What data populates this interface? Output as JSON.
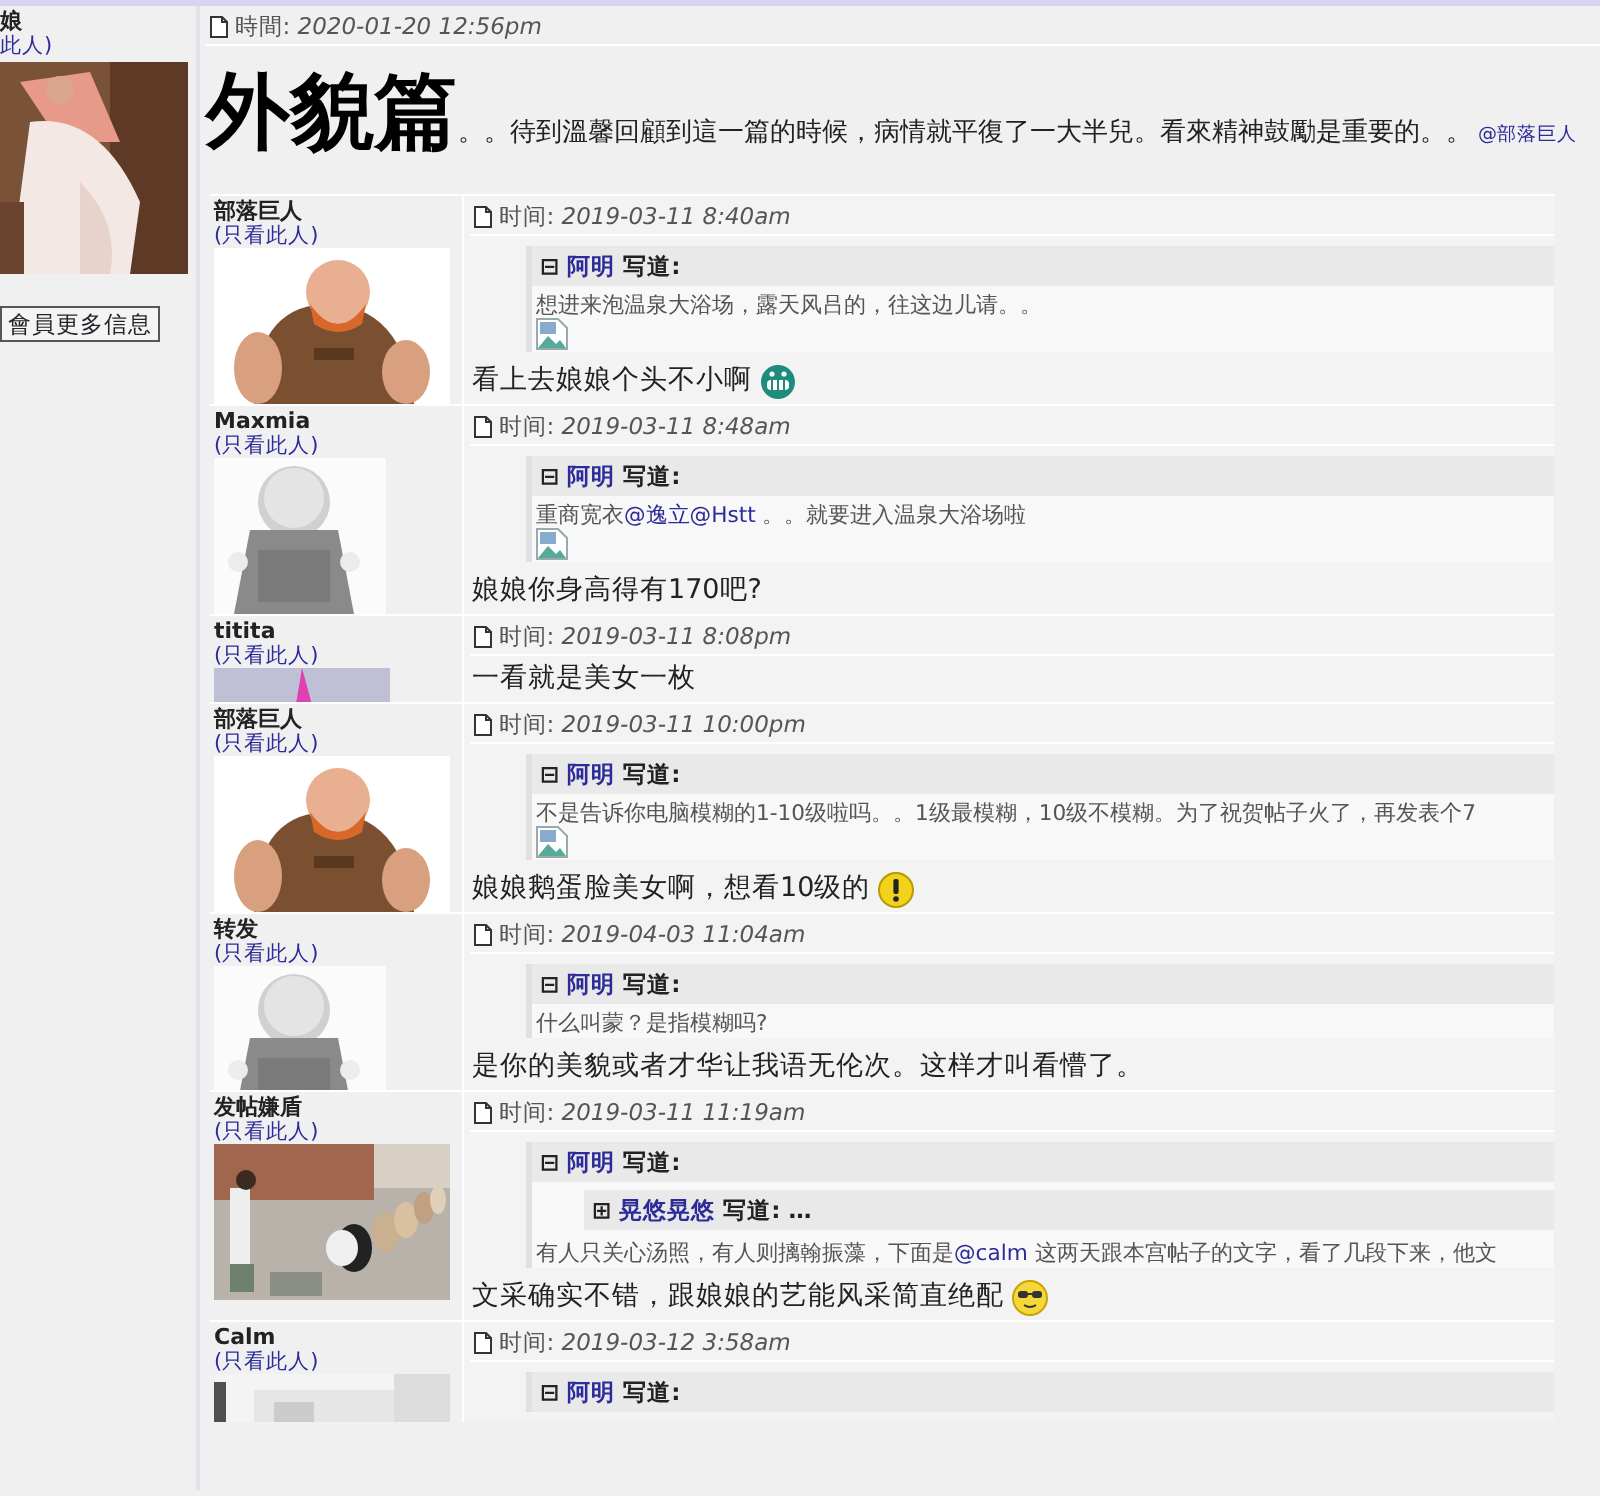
{
  "sidebar": {
    "username": "娘",
    "view_link": "此人)",
    "button": "會員更多信息"
  },
  "post": {
    "time_label": "時間:",
    "time": "2020-01-20 12:56pm",
    "title": "外貌篇",
    "body": "。。待到溫馨回顧到這一篇的時候，病情就平復了一大半兒。看來精神鼓勵是重要的。。",
    "mention": "@部落巨人"
  },
  "replies": [
    {
      "username": "部落巨人",
      "view_link": "(只看此人)",
      "time_label": "时间:",
      "time": "2019-03-11 8:40am",
      "quote": {
        "toggle": "⊟",
        "author": "阿明",
        "says": "写道:",
        "segments": [
          {
            "kind": "text",
            "text": "想进来泡温泉大浴场，露天风吕的，往这边儿请。。"
          }
        ],
        "broken_image": true
      },
      "text": "看上去娘娘个头不小啊",
      "emoji": {
        "kind": "grin"
      }
    },
    {
      "username": "Maxmia",
      "view_link": "(只看此人)",
      "time_label": "时间:",
      "time": "2019-03-11 8:48am",
      "quote": {
        "toggle": "⊟",
        "author": "阿明",
        "says": "写道:",
        "segments": [
          {
            "kind": "text",
            "text": "重商宽衣"
          },
          {
            "kind": "link",
            "text": "@逸立"
          },
          {
            "kind": "link",
            "text": "@Hstt"
          },
          {
            "kind": "text",
            "text": " 。。就要进入温泉大浴场啦"
          }
        ],
        "broken_image": true
      },
      "text": "娘娘你身高得有170吧?"
    },
    {
      "username": "titita",
      "view_link": "(只看此人)",
      "time_label": "时间:",
      "time": "2019-03-11 8:08pm",
      "text": "一看就是美女一枚"
    },
    {
      "username": "部落巨人",
      "view_link": "(只看此人)",
      "time_label": "时间:",
      "time": "2019-03-11 10:00pm",
      "quote": {
        "toggle": "⊟",
        "author": "阿明",
        "says": "写道:",
        "segments": [
          {
            "kind": "text",
            "text": "不是告诉你电脑模糊的1-10级啦吗。。1级最模糊，10级不模糊。为了祝贺帖子火了，再发表个7"
          }
        ],
        "broken_image": true
      },
      "text": "娘娘鹅蛋脸美女啊，想看10级的",
      "emoji": {
        "kind": "exclaim"
      }
    },
    {
      "username": "转发",
      "view_link": "(只看此人)",
      "time_label": "时间:",
      "time": "2019-04-03 11:04am",
      "quote": {
        "toggle": "⊟",
        "author": "阿明",
        "says": "写道:",
        "segments": [
          {
            "kind": "text",
            "text": "什么叫蒙？是指模糊吗?"
          }
        ],
        "broken_image": false
      },
      "text": "是你的美貌或者才华让我语无伦次。这样才叫看懵了。"
    },
    {
      "username": "发帖嫌盾",
      "view_link": "(只看此人)",
      "time_label": "时间:",
      "time": "2019-03-11 11:19am",
      "quote": {
        "toggle": "⊟",
        "author": "阿明",
        "says": "写道:",
        "nested": {
          "toggle": "⊞",
          "author": "晃悠晃悠",
          "says": "写道:",
          "ellipsis": "…"
        },
        "segments": [
          {
            "kind": "text",
            "text": "有人只关心汤照，有人则摛翰振藻，下面是"
          },
          {
            "kind": "link",
            "text": "@calm"
          },
          {
            "kind": "text",
            "text": " 这两天跟本宫帖子的文字，看了几段下来，他文"
          }
        ],
        "broken_image": false
      },
      "text": "文采确实不错，跟娘娘的艺能风采简直绝配",
      "emoji": {
        "kind": "cool"
      }
    },
    {
      "username": "Calm",
      "view_link": "(只看此人)",
      "time_label": "时间:",
      "time": "2019-03-12 3:58am",
      "quote": {
        "toggle": "⊟",
        "author": "阿明",
        "says": "写道:",
        "broken_image": false
      }
    }
  ]
}
